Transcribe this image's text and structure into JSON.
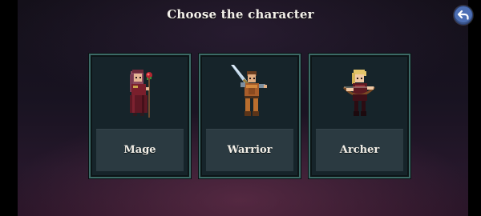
{
  "screen": {
    "title": "Choose the character"
  },
  "back_button": {
    "icon": "back-arrow-icon"
  },
  "characters": [
    {
      "label": "Mage",
      "sprite": "mage-sprite"
    },
    {
      "label": "Warrior",
      "sprite": "warrior-sprite"
    },
    {
      "label": "Archer",
      "sprite": "archer-sprite"
    }
  ],
  "colors": {
    "card_border": "#3c6a66",
    "card_bg": "#16242a",
    "label_box": "#2b3a41",
    "back_button": "#4d6fb4"
  }
}
